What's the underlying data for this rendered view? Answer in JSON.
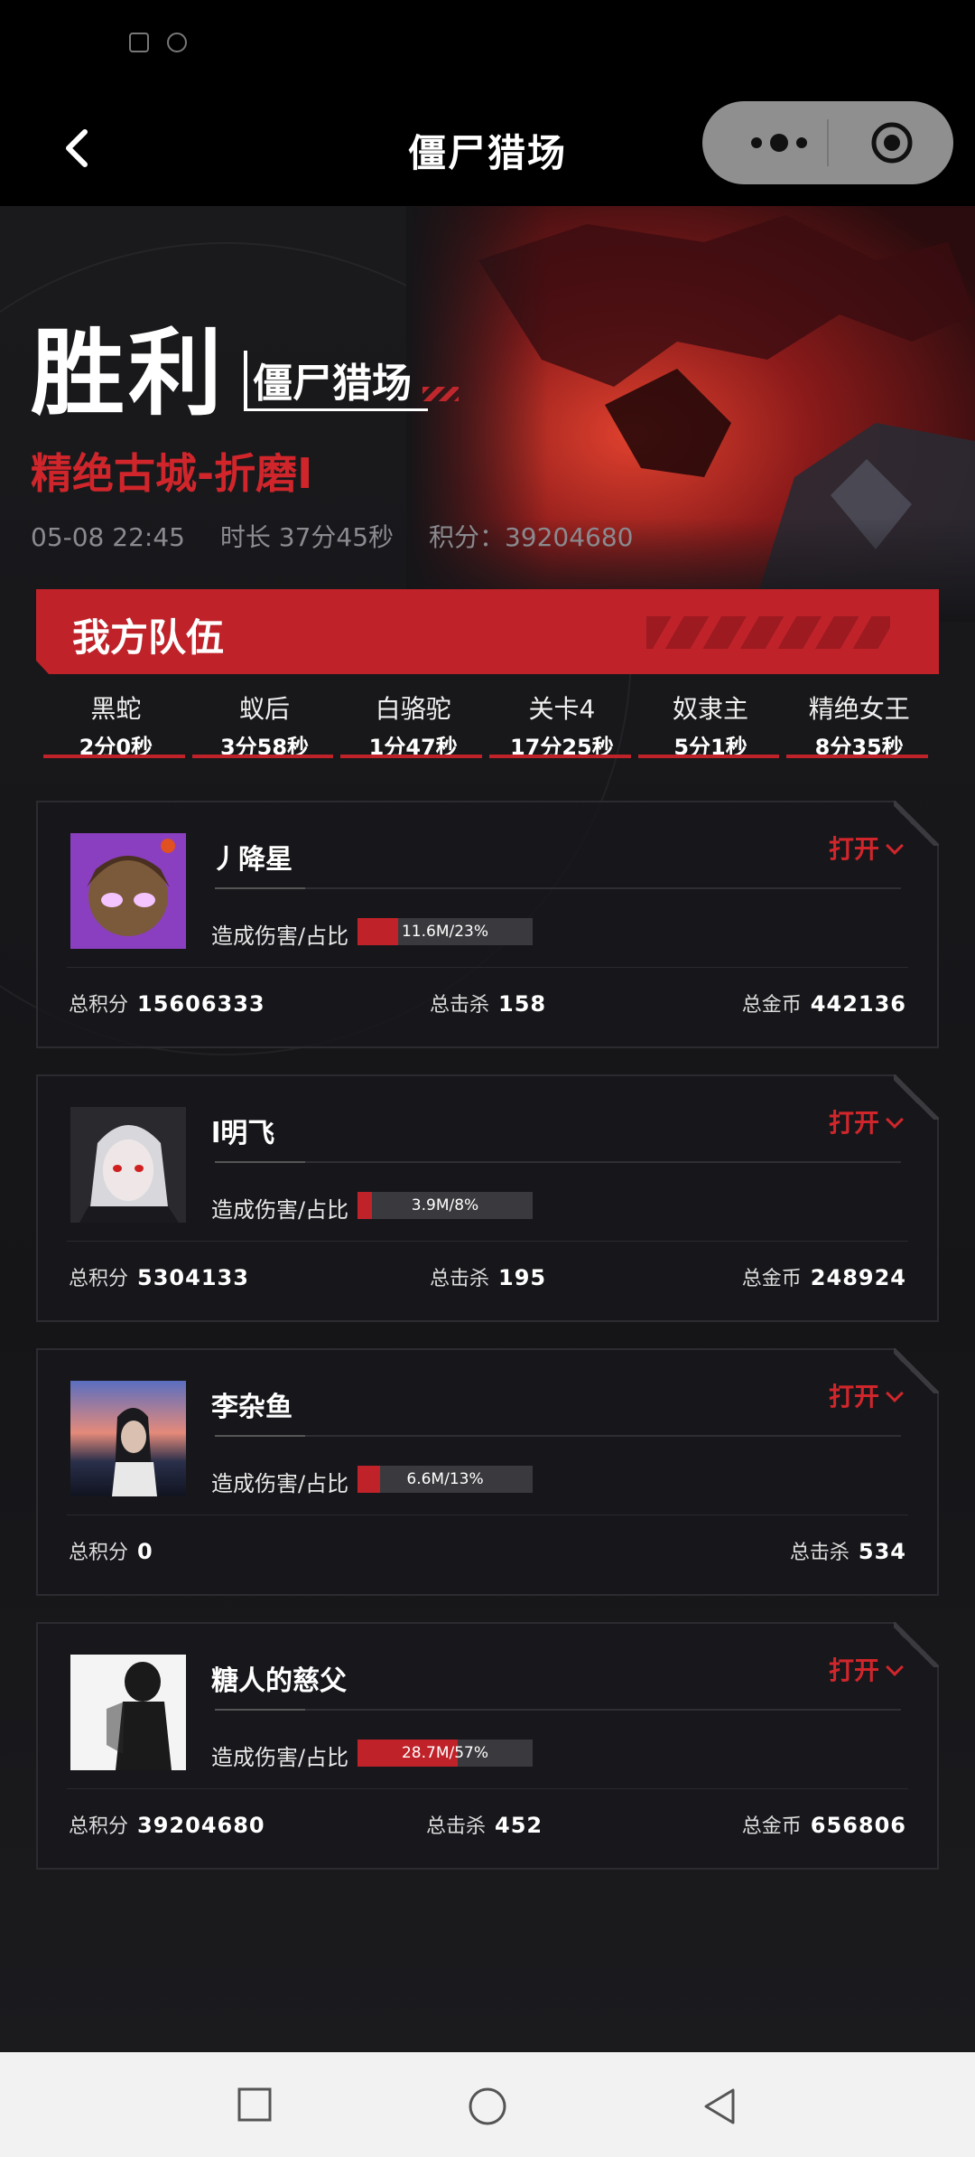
{
  "nav": {
    "title": "僵尸猎场"
  },
  "result": {
    "title": "胜利",
    "mode": "僵尸猎场",
    "map": "精绝古城-折磨I",
    "datetime": "05-08 22:45",
    "duration": "时长 37分45秒",
    "score": "积分：39204680"
  },
  "team": {
    "label": "我方队伍",
    "bosses": [
      {
        "name": "黑蛇",
        "time": "2分0秒"
      },
      {
        "name": "蚁后",
        "time": "3分58秒"
      },
      {
        "name": "白骆驼",
        "time": "1分47秒"
      },
      {
        "name": "关卡4",
        "time": "17分25秒"
      },
      {
        "name": "奴隶主",
        "time": "5分1秒"
      },
      {
        "name": "精绝女王",
        "time": "8分35秒"
      }
    ]
  },
  "labels": {
    "open": "打开",
    "damage": "造成伤害/占比",
    "total_score": "总积分",
    "total_kills": "总击杀",
    "total_gold": "总金币"
  },
  "players": [
    {
      "name": "丿降星",
      "damage_text": "11.6M/23%",
      "damage_pct": 23,
      "score": "15606333",
      "kills": "158",
      "gold": "442136"
    },
    {
      "name": "l明飞",
      "damage_text": "3.9M/8%",
      "damage_pct": 8,
      "score": "5304133",
      "kills": "195",
      "gold": "248924"
    },
    {
      "name": "李杂鱼",
      "damage_text": "6.6M/13%",
      "damage_pct": 13,
      "score": "0",
      "kills": "534",
      "gold": ""
    },
    {
      "name": "糖人的慈父",
      "damage_text": "28.7M/57%",
      "damage_pct": 57,
      "score": "39204680",
      "kills": "452",
      "gold": "656806"
    }
  ],
  "colors": {
    "accent": "#c0222a",
    "background": "#151518"
  }
}
